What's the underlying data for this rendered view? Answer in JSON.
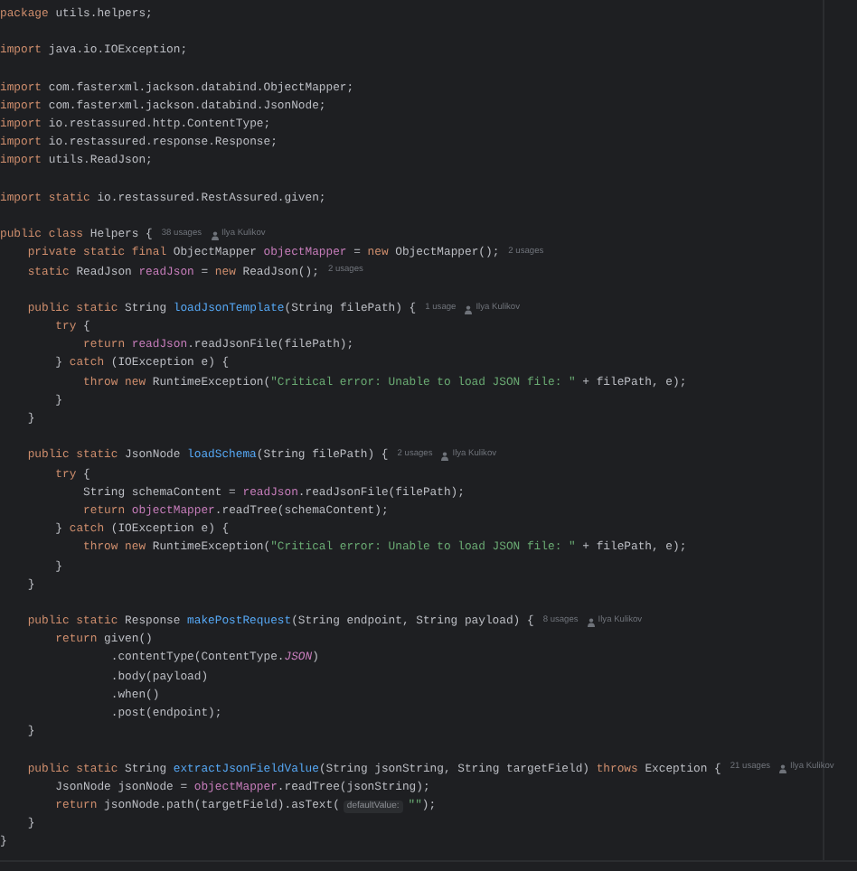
{
  "lines": [
    {
      "segments": [
        {
          "kind": "code",
          "tokens": [
            {
              "kind": "kw",
              "text": "package "
            },
            {
              "kind": "txt",
              "text": "utils.helpers;"
            }
          ]
        }
      ]
    },
    {
      "gap_before": true,
      "segments": [
        {
          "kind": "code",
          "tokens": [
            {
              "kind": "kw",
              "text": "import "
            },
            {
              "kind": "txt",
              "text": "java.io.IOException;"
            }
          ]
        }
      ]
    },
    {
      "gap_before": true,
      "segments": [
        {
          "kind": "code",
          "tokens": [
            {
              "kind": "kw",
              "text": "import "
            },
            {
              "kind": "txt",
              "text": "com.fasterxml.jackson.databind.ObjectMapper;"
            }
          ]
        }
      ]
    },
    {
      "segments": [
        {
          "kind": "code",
          "tokens": [
            {
              "kind": "kw",
              "text": "import "
            },
            {
              "kind": "txt",
              "text": "com.fasterxml.jackson.databind.JsonNode;"
            }
          ]
        }
      ]
    },
    {
      "segments": [
        {
          "kind": "code",
          "tokens": [
            {
              "kind": "kw",
              "text": "import "
            },
            {
              "kind": "txt",
              "text": "io.restassured.http.ContentType;"
            }
          ]
        }
      ]
    },
    {
      "segments": [
        {
          "kind": "code",
          "tokens": [
            {
              "kind": "kw",
              "text": "import "
            },
            {
              "kind": "txt",
              "text": "io.restassured.response.Response;"
            }
          ]
        }
      ]
    },
    {
      "segments": [
        {
          "kind": "code",
          "tokens": [
            {
              "kind": "kw",
              "text": "import "
            },
            {
              "kind": "txt",
              "text": "utils.ReadJson;"
            }
          ]
        }
      ]
    },
    {
      "gap_before": true,
      "segments": [
        {
          "kind": "code",
          "tokens": [
            {
              "kind": "kw",
              "text": "import static "
            },
            {
              "kind": "txt",
              "text": "io.restassured.RestAssured.given;"
            }
          ]
        }
      ]
    },
    {
      "gap_before": true,
      "segments": [
        {
          "kind": "code",
          "tokens": [
            {
              "kind": "kw",
              "text": "public class "
            },
            {
              "kind": "txt",
              "text": "Helpers {"
            }
          ]
        },
        {
          "kind": "usages",
          "text": "38 usages"
        },
        {
          "kind": "author",
          "text": "Ilya Kulikov"
        }
      ]
    },
    {
      "segments": [
        {
          "kind": "code",
          "tokens": [
            {
              "kind": "kw",
              "text": "    private static final "
            },
            {
              "kind": "txt",
              "text": "ObjectMapper "
            },
            {
              "kind": "fld",
              "text": "objectMapper"
            },
            {
              "kind": "txt",
              "text": " = "
            },
            {
              "kind": "kw",
              "text": "new "
            },
            {
              "kind": "txt",
              "text": "ObjectMapper();"
            }
          ]
        },
        {
          "kind": "usages",
          "text": "2 usages"
        }
      ]
    },
    {
      "segments": [
        {
          "kind": "code",
          "tokens": [
            {
              "kind": "kw",
              "text": "    static "
            },
            {
              "kind": "txt",
              "text": "ReadJson "
            },
            {
              "kind": "fld",
              "text": "readJson"
            },
            {
              "kind": "txt",
              "text": " = "
            },
            {
              "kind": "kw",
              "text": "new "
            },
            {
              "kind": "txt",
              "text": "ReadJson();"
            }
          ]
        },
        {
          "kind": "usages",
          "text": "2 usages"
        }
      ]
    },
    {
      "gap_before": true,
      "segments": [
        {
          "kind": "code",
          "tokens": [
            {
              "kind": "kw",
              "text": "    public static "
            },
            {
              "kind": "txt",
              "text": "String "
            },
            {
              "kind": "fn",
              "text": "loadJsonTemplate"
            },
            {
              "kind": "txt",
              "text": "(String filePath) {"
            }
          ]
        },
        {
          "kind": "usages",
          "text": "1 usage"
        },
        {
          "kind": "author",
          "text": "Ilya Kulikov"
        }
      ]
    },
    {
      "segments": [
        {
          "kind": "code",
          "tokens": [
            {
              "kind": "kw",
              "text": "        try "
            },
            {
              "kind": "txt",
              "text": "{"
            }
          ]
        }
      ]
    },
    {
      "segments": [
        {
          "kind": "code",
          "tokens": [
            {
              "kind": "kw",
              "text": "            return "
            },
            {
              "kind": "fld",
              "text": "readJson"
            },
            {
              "kind": "txt",
              "text": ".readJsonFile(filePath);"
            }
          ]
        }
      ]
    },
    {
      "segments": [
        {
          "kind": "code",
          "tokens": [
            {
              "kind": "txt",
              "text": "        } "
            },
            {
              "kind": "kw",
              "text": "catch "
            },
            {
              "kind": "txt",
              "text": "(IOException e) {"
            }
          ]
        }
      ]
    },
    {
      "segments": [
        {
          "kind": "code",
          "tokens": [
            {
              "kind": "kw",
              "text": "            throw new "
            },
            {
              "kind": "txt",
              "text": "RuntimeException("
            },
            {
              "kind": "str",
              "text": "\"Critical error: Unable to load JSON file: \""
            },
            {
              "kind": "txt",
              "text": " + filePath, e);"
            }
          ]
        }
      ]
    },
    {
      "segments": [
        {
          "kind": "code",
          "tokens": [
            {
              "kind": "txt",
              "text": "        }"
            }
          ]
        }
      ]
    },
    {
      "segments": [
        {
          "kind": "code",
          "tokens": [
            {
              "kind": "txt",
              "text": "    }"
            }
          ]
        }
      ]
    },
    {
      "gap_before": true,
      "segments": [
        {
          "kind": "code",
          "tokens": [
            {
              "kind": "kw",
              "text": "    public static "
            },
            {
              "kind": "txt",
              "text": "JsonNode "
            },
            {
              "kind": "fn",
              "text": "loadSchema"
            },
            {
              "kind": "txt",
              "text": "(String filePath) {"
            }
          ]
        },
        {
          "kind": "usages",
          "text": "2 usages"
        },
        {
          "kind": "author",
          "text": "Ilya Kulikov"
        }
      ]
    },
    {
      "segments": [
        {
          "kind": "code",
          "tokens": [
            {
              "kind": "kw",
              "text": "        try "
            },
            {
              "kind": "txt",
              "text": "{"
            }
          ]
        }
      ]
    },
    {
      "segments": [
        {
          "kind": "code",
          "tokens": [
            {
              "kind": "txt",
              "text": "            String schemaContent = "
            },
            {
              "kind": "fld",
              "text": "readJson"
            },
            {
              "kind": "txt",
              "text": ".readJsonFile(filePath);"
            }
          ]
        }
      ]
    },
    {
      "segments": [
        {
          "kind": "code",
          "tokens": [
            {
              "kind": "kw",
              "text": "            return "
            },
            {
              "kind": "fld",
              "text": "objectMapper"
            },
            {
              "kind": "txt",
              "text": ".readTree(schemaContent);"
            }
          ]
        }
      ]
    },
    {
      "segments": [
        {
          "kind": "code",
          "tokens": [
            {
              "kind": "txt",
              "text": "        } "
            },
            {
              "kind": "kw",
              "text": "catch "
            },
            {
              "kind": "txt",
              "text": "(IOException e) {"
            }
          ]
        }
      ]
    },
    {
      "segments": [
        {
          "kind": "code",
          "tokens": [
            {
              "kind": "kw",
              "text": "            throw new "
            },
            {
              "kind": "txt",
              "text": "RuntimeException("
            },
            {
              "kind": "str",
              "text": "\"Critical error: Unable to load JSON file: \""
            },
            {
              "kind": "txt",
              "text": " + filePath, e);"
            }
          ]
        }
      ]
    },
    {
      "segments": [
        {
          "kind": "code",
          "tokens": [
            {
              "kind": "txt",
              "text": "        }"
            }
          ]
        }
      ]
    },
    {
      "segments": [
        {
          "kind": "code",
          "tokens": [
            {
              "kind": "txt",
              "text": "    }"
            }
          ]
        }
      ]
    },
    {
      "gap_before": true,
      "segments": [
        {
          "kind": "code",
          "tokens": [
            {
              "kind": "kw",
              "text": "    public static "
            },
            {
              "kind": "txt",
              "text": "Response "
            },
            {
              "kind": "fn",
              "text": "makePostRequest"
            },
            {
              "kind": "txt",
              "text": "(String endpoint, String payload) {"
            }
          ]
        },
        {
          "kind": "usages",
          "text": "8 usages"
        },
        {
          "kind": "author",
          "text": "Ilya Kulikov"
        }
      ]
    },
    {
      "segments": [
        {
          "kind": "code",
          "tokens": [
            {
              "kind": "kw",
              "text": "        return "
            },
            {
              "kind": "txt",
              "text": "given()"
            }
          ]
        }
      ]
    },
    {
      "segments": [
        {
          "kind": "code",
          "tokens": [
            {
              "kind": "txt",
              "text": "                .contentType(ContentType."
            },
            {
              "kind": "cst",
              "text": "JSON"
            },
            {
              "kind": "txt",
              "text": ")"
            }
          ]
        }
      ]
    },
    {
      "segments": [
        {
          "kind": "code",
          "tokens": [
            {
              "kind": "txt",
              "text": "                .body(payload)"
            }
          ]
        }
      ]
    },
    {
      "segments": [
        {
          "kind": "code",
          "tokens": [
            {
              "kind": "txt",
              "text": "                .when()"
            }
          ]
        }
      ]
    },
    {
      "segments": [
        {
          "kind": "code",
          "tokens": [
            {
              "kind": "txt",
              "text": "                .post(endpoint);"
            }
          ]
        }
      ]
    },
    {
      "segments": [
        {
          "kind": "code",
          "tokens": [
            {
              "kind": "txt",
              "text": "    }"
            }
          ]
        }
      ]
    },
    {
      "gap_before": true,
      "segments": [
        {
          "kind": "code",
          "tokens": [
            {
              "kind": "kw",
              "text": "    public static "
            },
            {
              "kind": "txt",
              "text": "String "
            },
            {
              "kind": "fn",
              "text": "extractJsonFieldValue"
            },
            {
              "kind": "txt",
              "text": "(String jsonString, String targetField) "
            },
            {
              "kind": "kw",
              "text": "throws "
            },
            {
              "kind": "txt",
              "text": "Exception {"
            }
          ]
        },
        {
          "kind": "usages",
          "text": "21 usages"
        },
        {
          "kind": "author",
          "text": "Ilya Kulikov"
        }
      ]
    },
    {
      "segments": [
        {
          "kind": "code",
          "tokens": [
            {
              "kind": "txt",
              "text": "        JsonNode jsonNode = "
            },
            {
              "kind": "fld",
              "text": "objectMapper"
            },
            {
              "kind": "txt",
              "text": ".readTree(jsonString);"
            }
          ]
        }
      ]
    },
    {
      "segments": [
        {
          "kind": "code",
          "tokens": [
            {
              "kind": "kw",
              "text": "        return "
            },
            {
              "kind": "txt",
              "text": "jsonNode.path(targetField).asText("
            }
          ]
        },
        {
          "kind": "param",
          "text": "defaultValue:"
        },
        {
          "kind": "code",
          "tokens": [
            {
              "kind": "str",
              "text": "\"\""
            },
            {
              "kind": "txt",
              "text": ");"
            }
          ]
        }
      ]
    },
    {
      "segments": [
        {
          "kind": "code",
          "tokens": [
            {
              "kind": "txt",
              "text": "    }"
            }
          ]
        }
      ]
    },
    {
      "segments": [
        {
          "kind": "code",
          "tokens": [
            {
              "kind": "txt",
              "text": "}"
            }
          ]
        }
      ]
    }
  ]
}
